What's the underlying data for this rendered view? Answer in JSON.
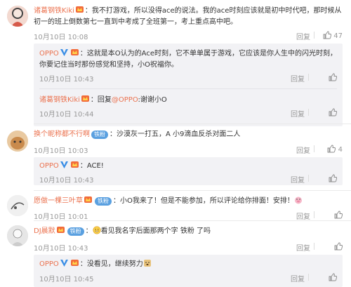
{
  "comments": [
    {
      "user": "诸葛钢铁Kiki",
      "text": "我不打游戏，所以没得ace的说法。我的ace时刻应该就是初中时代吧，那时候从初一的班上倒数第七一直到中考成了全班第一，考上重点高中吧。",
      "time": "10月10日 10:08",
      "reply_label": "回复",
      "likes": "47",
      "replies": [
        {
          "user": "OPPO",
          "text": "这就是本O认为的Ace时刻，它不单单属于游戏，它应该是你人生中的闪光时刻，你要记住当时那份感觉和坚持，小O祝福你。",
          "time": "10月10日 10:43",
          "reply_label": "回复",
          "likes": "赞"
        },
        {
          "user": "诸葛钢铁Kiki",
          "prefix": "回复",
          "mention": "@OPPO",
          "text": "谢谢小O",
          "time": "10月10日 10:44",
          "reply_label": "回复",
          "likes": "赞"
        }
      ]
    },
    {
      "user": "换个昵称都不行啊",
      "fan_badge": "铁粉",
      "text": "沙漠灰一打五，A 小9滴血反杀对面二人",
      "time": "10月10日 10:03",
      "reply_label": "回复",
      "likes": "4",
      "replies": [
        {
          "user": "OPPO",
          "text": "ACE!",
          "time": "10月10日 10:43",
          "reply_label": "回复",
          "likes": "赞"
        }
      ]
    },
    {
      "user": "愿做一棵三叶草",
      "fan_badge": "铁粉",
      "text": "小O我来了！但是不能参加，所以评论给你排面！安排！",
      "time": "10月10日 10:01",
      "reply_label": "回复",
      "likes": "赞"
    },
    {
      "user": "DJ晨默",
      "fan_badge": "铁粉",
      "text": "看见我名字后面那两个字 铁粉 了吗",
      "time": "10月10日 10:43",
      "reply_label": "回复",
      "likes": "赞",
      "replies": [
        {
          "user": "OPPO",
          "text": "没看见，继续努力",
          "time": "10月10日 10:45",
          "reply_label": "回复",
          "likes": "赞"
        }
      ]
    }
  ],
  "colors": {
    "username": "#eb7350",
    "meta": "#999999",
    "subbox_bg": "#f2f2f5",
    "fan_badge": "#5aa0e0"
  }
}
